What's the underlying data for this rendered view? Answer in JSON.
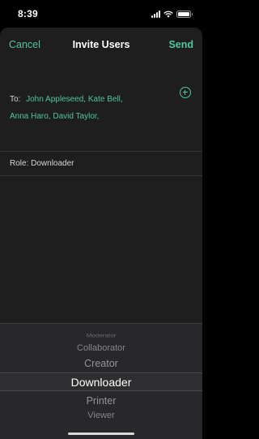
{
  "status_bar": {
    "time": "8:39"
  },
  "nav": {
    "cancel_label": "Cancel",
    "title": "Invite Users",
    "send_label": "Send"
  },
  "recipients": {
    "prefix": "To:",
    "names": [
      "John Appleseed,",
      "Kate Bell,",
      "Anna Haro,",
      "David Taylor,"
    ]
  },
  "role": {
    "label": "Role: Downloader"
  },
  "picker": {
    "options": [
      "Moderator",
      "Collaborator",
      "Creator",
      "Downloader",
      "Printer",
      "Viewer"
    ],
    "selected": "Downloader"
  },
  "colors": {
    "accent": "#4fc69e",
    "background": "#1e1e1f",
    "picker_background": "#28282a"
  }
}
